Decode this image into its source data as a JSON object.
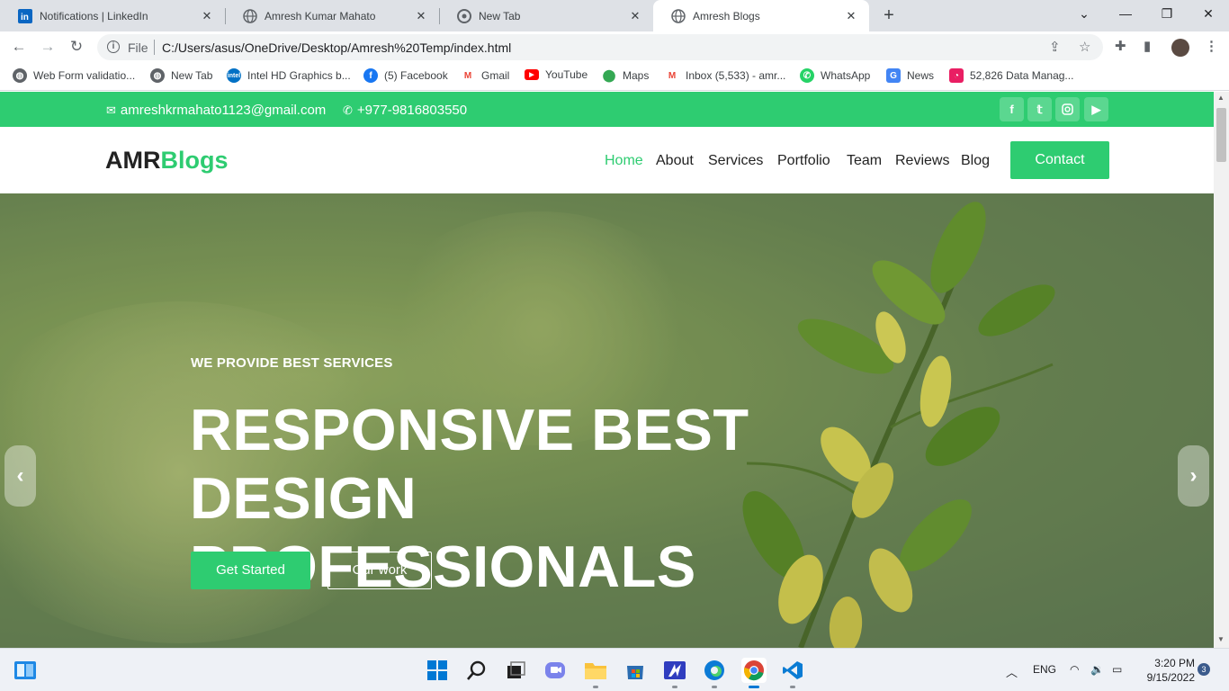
{
  "browser": {
    "tabs": [
      {
        "title": "Notifications | LinkedIn",
        "icon": "linkedin-icon",
        "active": false
      },
      {
        "title": "Amresh Kumar Mahato",
        "icon": "globe-icon",
        "active": false
      },
      {
        "title": "New Tab",
        "icon": "chrome-icon",
        "active": false
      },
      {
        "title": "Amresh Blogs",
        "icon": "globe-icon",
        "active": true
      }
    ],
    "address": {
      "scheme_label": "File",
      "url": "C:/Users/asus/OneDrive/Desktop/Amresh%20Temp/index.html"
    },
    "bookmarks": [
      {
        "label": "Web Form validatio...",
        "icon": "globe-icon",
        "color": "#5f6368"
      },
      {
        "label": "New Tab",
        "icon": "globe-icon",
        "color": "#5f6368"
      },
      {
        "label": "Intel HD Graphics b...",
        "icon": "intel-icon",
        "color": "#0071c5"
      },
      {
        "label": "(5) Facebook",
        "icon": "facebook-icon",
        "color": "#1877f2"
      },
      {
        "label": "Gmail",
        "icon": "gmail-icon",
        "color": "#ea4335"
      },
      {
        "label": "YouTube",
        "icon": "youtube-icon",
        "color": "#ff0000"
      },
      {
        "label": "Maps",
        "icon": "maps-icon",
        "color": "#34a853"
      },
      {
        "label": "Inbox (5,533) - amr...",
        "icon": "gmail-icon",
        "color": "#ea4335"
      },
      {
        "label": "WhatsApp",
        "icon": "whatsapp-icon",
        "color": "#25d366"
      },
      {
        "label": "News",
        "icon": "news-icon",
        "color": "#4285f4"
      },
      {
        "label": "52,826 Data Manag...",
        "icon": "data-icon",
        "color": "#e91e63"
      }
    ]
  },
  "site": {
    "topbar": {
      "email": "amreshkrmahato1123@gmail.com",
      "phone": "+977-9816803550",
      "socials": [
        "facebook-icon",
        "twitter-icon",
        "instagram-icon",
        "youtube-icon"
      ]
    },
    "logo": {
      "part1": "AMR",
      "part2": "Blogs"
    },
    "nav": [
      {
        "label": "Home",
        "active": true
      },
      {
        "label": "About",
        "active": false
      },
      {
        "label": "Services",
        "active": false
      },
      {
        "label": "Portfolio",
        "active": false
      },
      {
        "label": "Team",
        "active": false
      },
      {
        "label": "Reviews",
        "active": false
      },
      {
        "label": "Blog",
        "active": false
      }
    ],
    "nav_cta": "Contact",
    "hero": {
      "eyebrow": "WE PROVIDE BEST SERVICES",
      "title_line1": "RESPONSIVE BEST DESIGN",
      "title_line2": "PROFESSIONALS",
      "primary_button": "Get Started",
      "secondary_button": "Our work",
      "prev_arrow": "‹",
      "next_arrow": "›"
    },
    "accent_color": "#2ecc71"
  },
  "taskbar": {
    "apps": [
      "start-icon",
      "search-icon",
      "task-view-icon",
      "teams-chat-icon",
      "file-explorer-icon",
      "microsoft-store-icon",
      "ide-icon",
      "edge-icon",
      "chrome-icon",
      "vscode-icon"
    ],
    "language": "ENG",
    "time": "3:20 PM",
    "date": "9/15/2022",
    "notification_count": "3"
  }
}
